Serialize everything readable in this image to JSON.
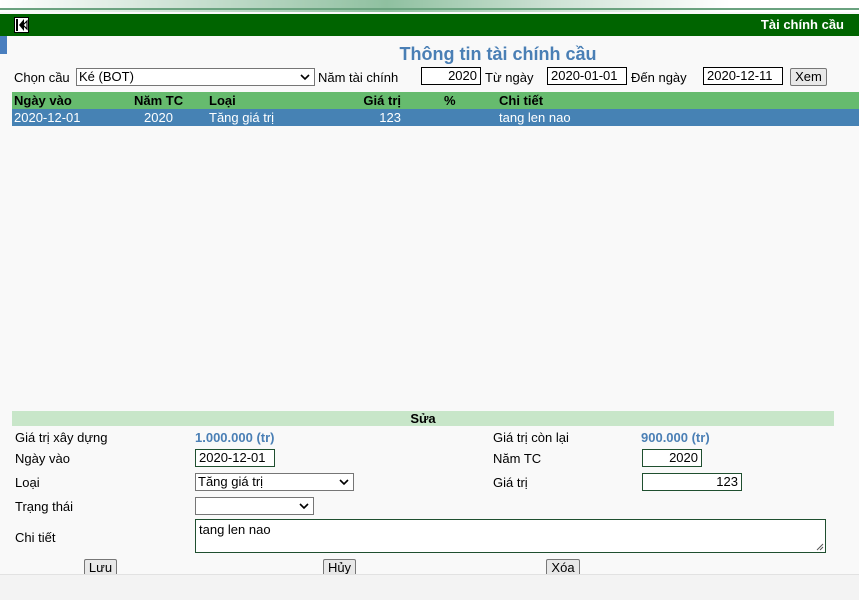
{
  "header": {
    "title": "Tài chính cầu"
  },
  "page_title": "Thông tin tài chính cầu",
  "filter": {
    "bridge_label": "Chọn cầu",
    "bridge_value": "Ké (BOT)",
    "fiscal_year_label": "Năm tài chính",
    "fiscal_year_value": "2020",
    "from_label": "Từ ngày",
    "from_value": "2020-01-01",
    "to_label": "Đến ngày",
    "to_value": "2020-12-11",
    "view_button": "Xem"
  },
  "table": {
    "columns": [
      "Ngày vào",
      "Năm TC",
      "Loại",
      "Giá trị",
      "%",
      "Chi tiết"
    ],
    "rows": [
      [
        "2020-12-01",
        "2020",
        "Tăng giá trị",
        "123",
        "",
        "tang len nao"
      ]
    ]
  },
  "edit": {
    "section_title": "Sửa",
    "construction_value_label": "Giá trị xây dựng",
    "construction_value": "1.000.000 (tr)",
    "remaining_value_label": "Giá trị còn lại",
    "remaining_value": "900.000 (tr)",
    "date_label": "Ngày vào",
    "date_value": "2020-12-01",
    "year_label": "Năm TC",
    "year_value": "2020",
    "type_label": "Loại",
    "type_value": "Tăng giá trị",
    "value_label": "Giá trị",
    "value_value": "123",
    "status_label": "Trạng thái",
    "status_value": "",
    "detail_label": "Chi tiết",
    "detail_value": "tang len nao",
    "save_button": "Lưu",
    "cancel_button": "Hủy",
    "delete_button": "Xóa"
  }
}
